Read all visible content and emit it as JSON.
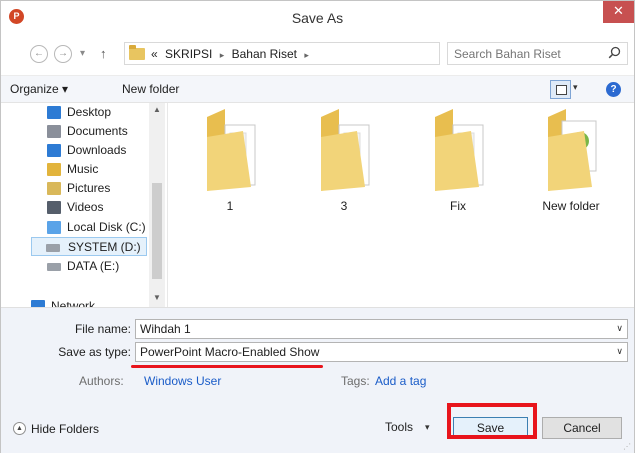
{
  "window": {
    "title": "Save As",
    "app_icon_letter": "P",
    "close_glyph": "✕"
  },
  "nav_buttons": {
    "back": "←",
    "forward": "→",
    "recent": "▾",
    "up": "↑"
  },
  "address": {
    "prefix": "«",
    "crumbs": [
      "SKRIPSI",
      "Bahan Riset"
    ],
    "separator": "▸",
    "dropdown": "∨",
    "refresh": "↻"
  },
  "search": {
    "placeholder": "Search Bahan Riset"
  },
  "toolbar": {
    "organize": "Organize ▾",
    "new_folder": "New folder",
    "view_dd": "▾",
    "help": "?"
  },
  "nav_pane": {
    "items": [
      {
        "label": "Desktop",
        "icon": "desktop-icon",
        "color": "#2d7bd4"
      },
      {
        "label": "Documents",
        "icon": "documents-icon",
        "color": "#8a8f9a"
      },
      {
        "label": "Downloads",
        "icon": "downloads-icon",
        "color": "#2d7bd4"
      },
      {
        "label": "Music",
        "icon": "music-icon",
        "color": "#e2b43c"
      },
      {
        "label": "Pictures",
        "icon": "pictures-icon",
        "color": "#d9b85a"
      },
      {
        "label": "Videos",
        "icon": "videos-icon",
        "color": "#555e6b"
      },
      {
        "label": "Local Disk (C:)",
        "icon": "local-disk-icon",
        "color": "#5aa3e8"
      },
      {
        "label": "SYSTEM (D:)",
        "icon": "drive-icon",
        "color": "#9aa0a8"
      },
      {
        "label": "DATA (E:)",
        "icon": "drive-icon",
        "color": "#9aa0a8"
      },
      {
        "label": "Network",
        "icon": "network-icon",
        "color": "#2d7bd4"
      }
    ],
    "scroll_up": "▲",
    "scroll_down": "▼"
  },
  "folders": [
    {
      "name": "1"
    },
    {
      "name": "3"
    },
    {
      "name": "Fix"
    },
    {
      "name": "New folder"
    }
  ],
  "fields": {
    "file_name_label": "File name:",
    "file_name_value": "Wihdah 1",
    "save_type_label": "Save as type:",
    "save_type_value": "PowerPoint Macro-Enabled Show",
    "dropdown_glyph": "∨",
    "authors_label": "Authors:",
    "authors_value": "Windows User",
    "tags_label": "Tags:",
    "tags_value": "Add a tag"
  },
  "footer": {
    "hide_folders": "Hide Folders",
    "hide_folders_glyph": "▲",
    "tools": "Tools",
    "tools_dd": "▾",
    "save": "Save",
    "cancel": "Cancel",
    "grip": "⋰"
  },
  "colors": {
    "annotation_red": "#e8141c",
    "link_blue": "#1a5cc8",
    "folder_yellow": "#f2d479"
  }
}
